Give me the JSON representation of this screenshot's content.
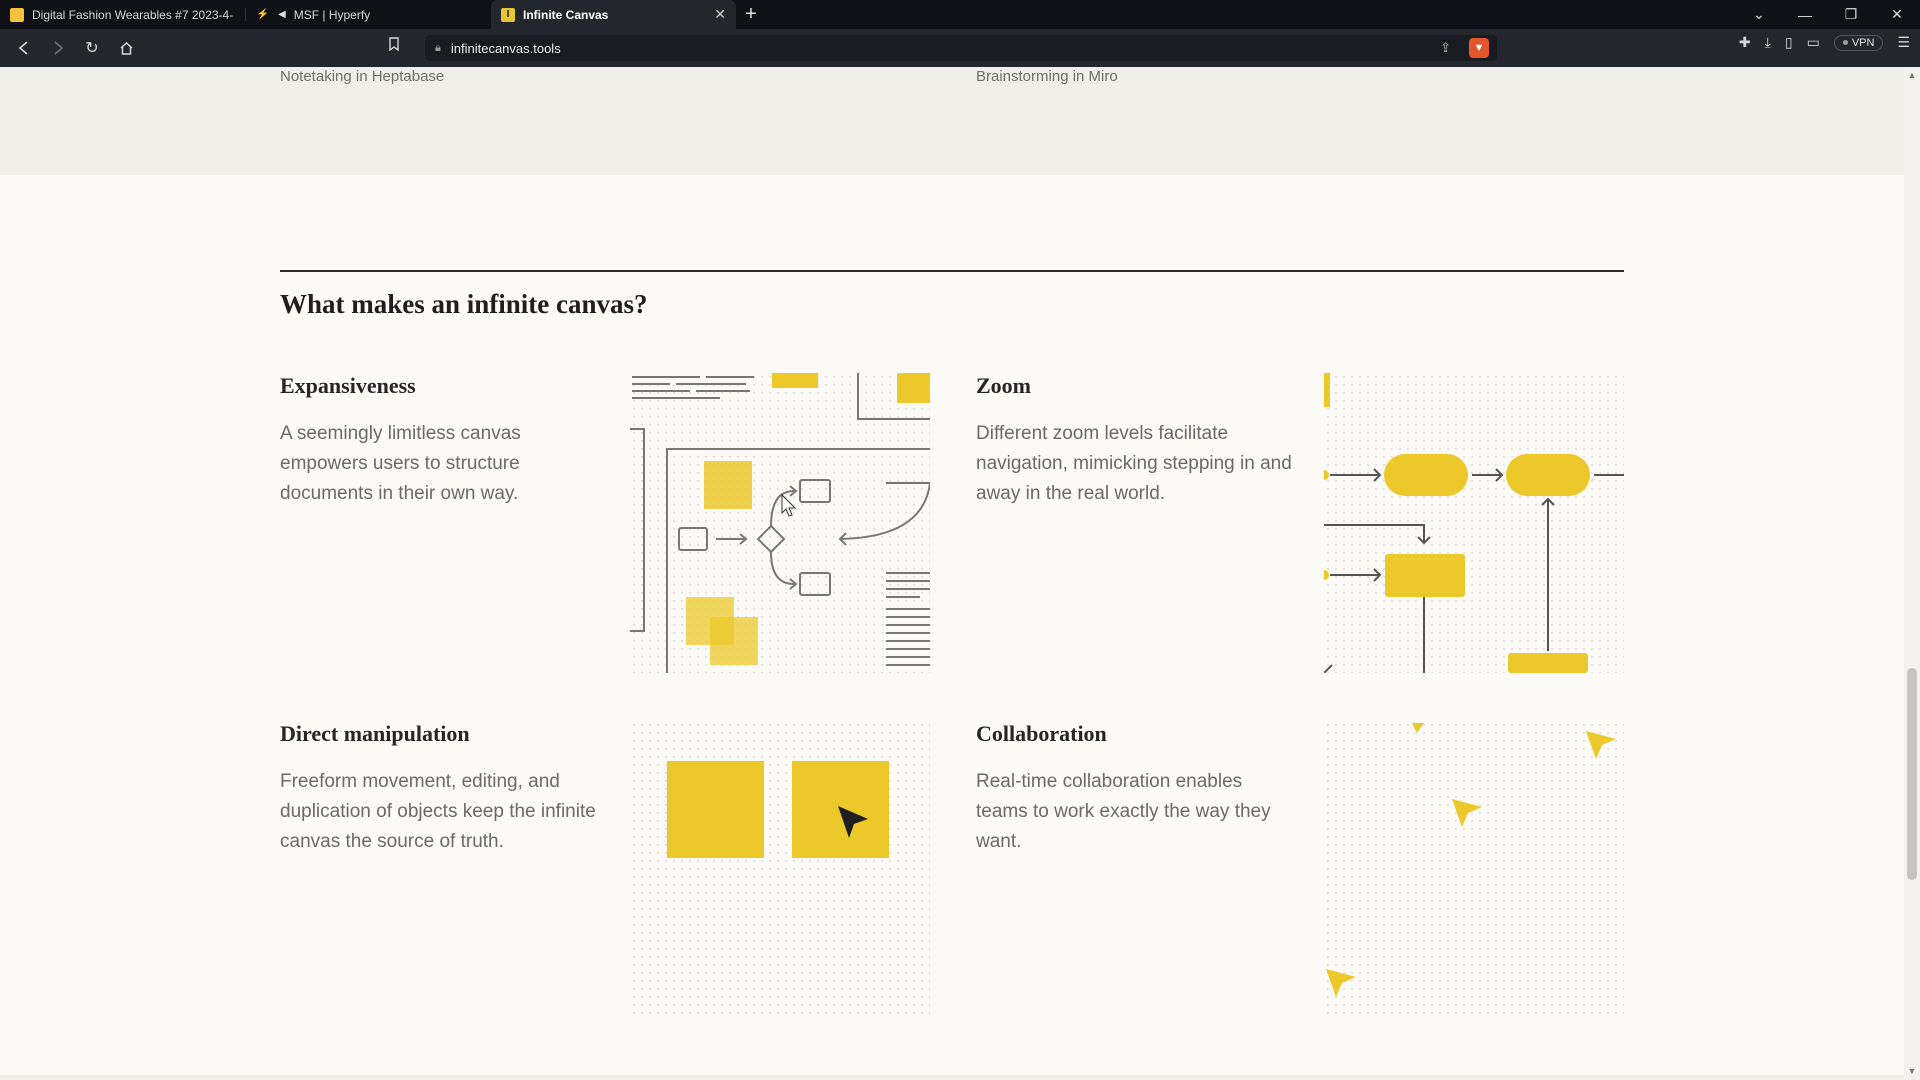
{
  "browser": {
    "tabs": [
      {
        "title": "Digital Fashion Wearables #7 2023-4-",
        "favicon_color": "#f4c33b",
        "active": false
      },
      {
        "title": "MSF | Hyperfy",
        "favicon_color": "#0f1117",
        "active": false,
        "muted_icon": "speaker-icon"
      },
      {
        "title": "Infinite Canvas",
        "favicon_color": "#e9c534",
        "favicon_letter": "I",
        "active": true
      }
    ],
    "new_tab": "+",
    "url": "infinitecanvas.tools",
    "vpn_label": "VPN",
    "window_controls": [
      "⌄",
      "—",
      "❐",
      "✕"
    ]
  },
  "page": {
    "captions": {
      "left": "Notetaking in Heptabase",
      "right": "Brainstorming in Miro"
    },
    "section_title": "What makes an infinite canvas?",
    "features": [
      {
        "title": "Expansiveness",
        "desc": "A seemingly limitless canvas empowers users to structure documents in their own way."
      },
      {
        "title": "Zoom",
        "desc": "Different zoom levels facilitate navigation, mimicking stepping in and away in the real world."
      },
      {
        "title": "Direct manipulation",
        "desc": "Freeform movement, editing, and duplication of objects keep the infinite canvas the source of truth."
      },
      {
        "title": "Collaboration",
        "desc": "Real-time collaboration enables teams to work exactly the way they want."
      }
    ]
  },
  "colors": {
    "accent_yellow": "#ecc82b",
    "page_bg": "#fbfaf7",
    "chrome_dark": "#0f1117",
    "toolbar": "#24262d"
  }
}
